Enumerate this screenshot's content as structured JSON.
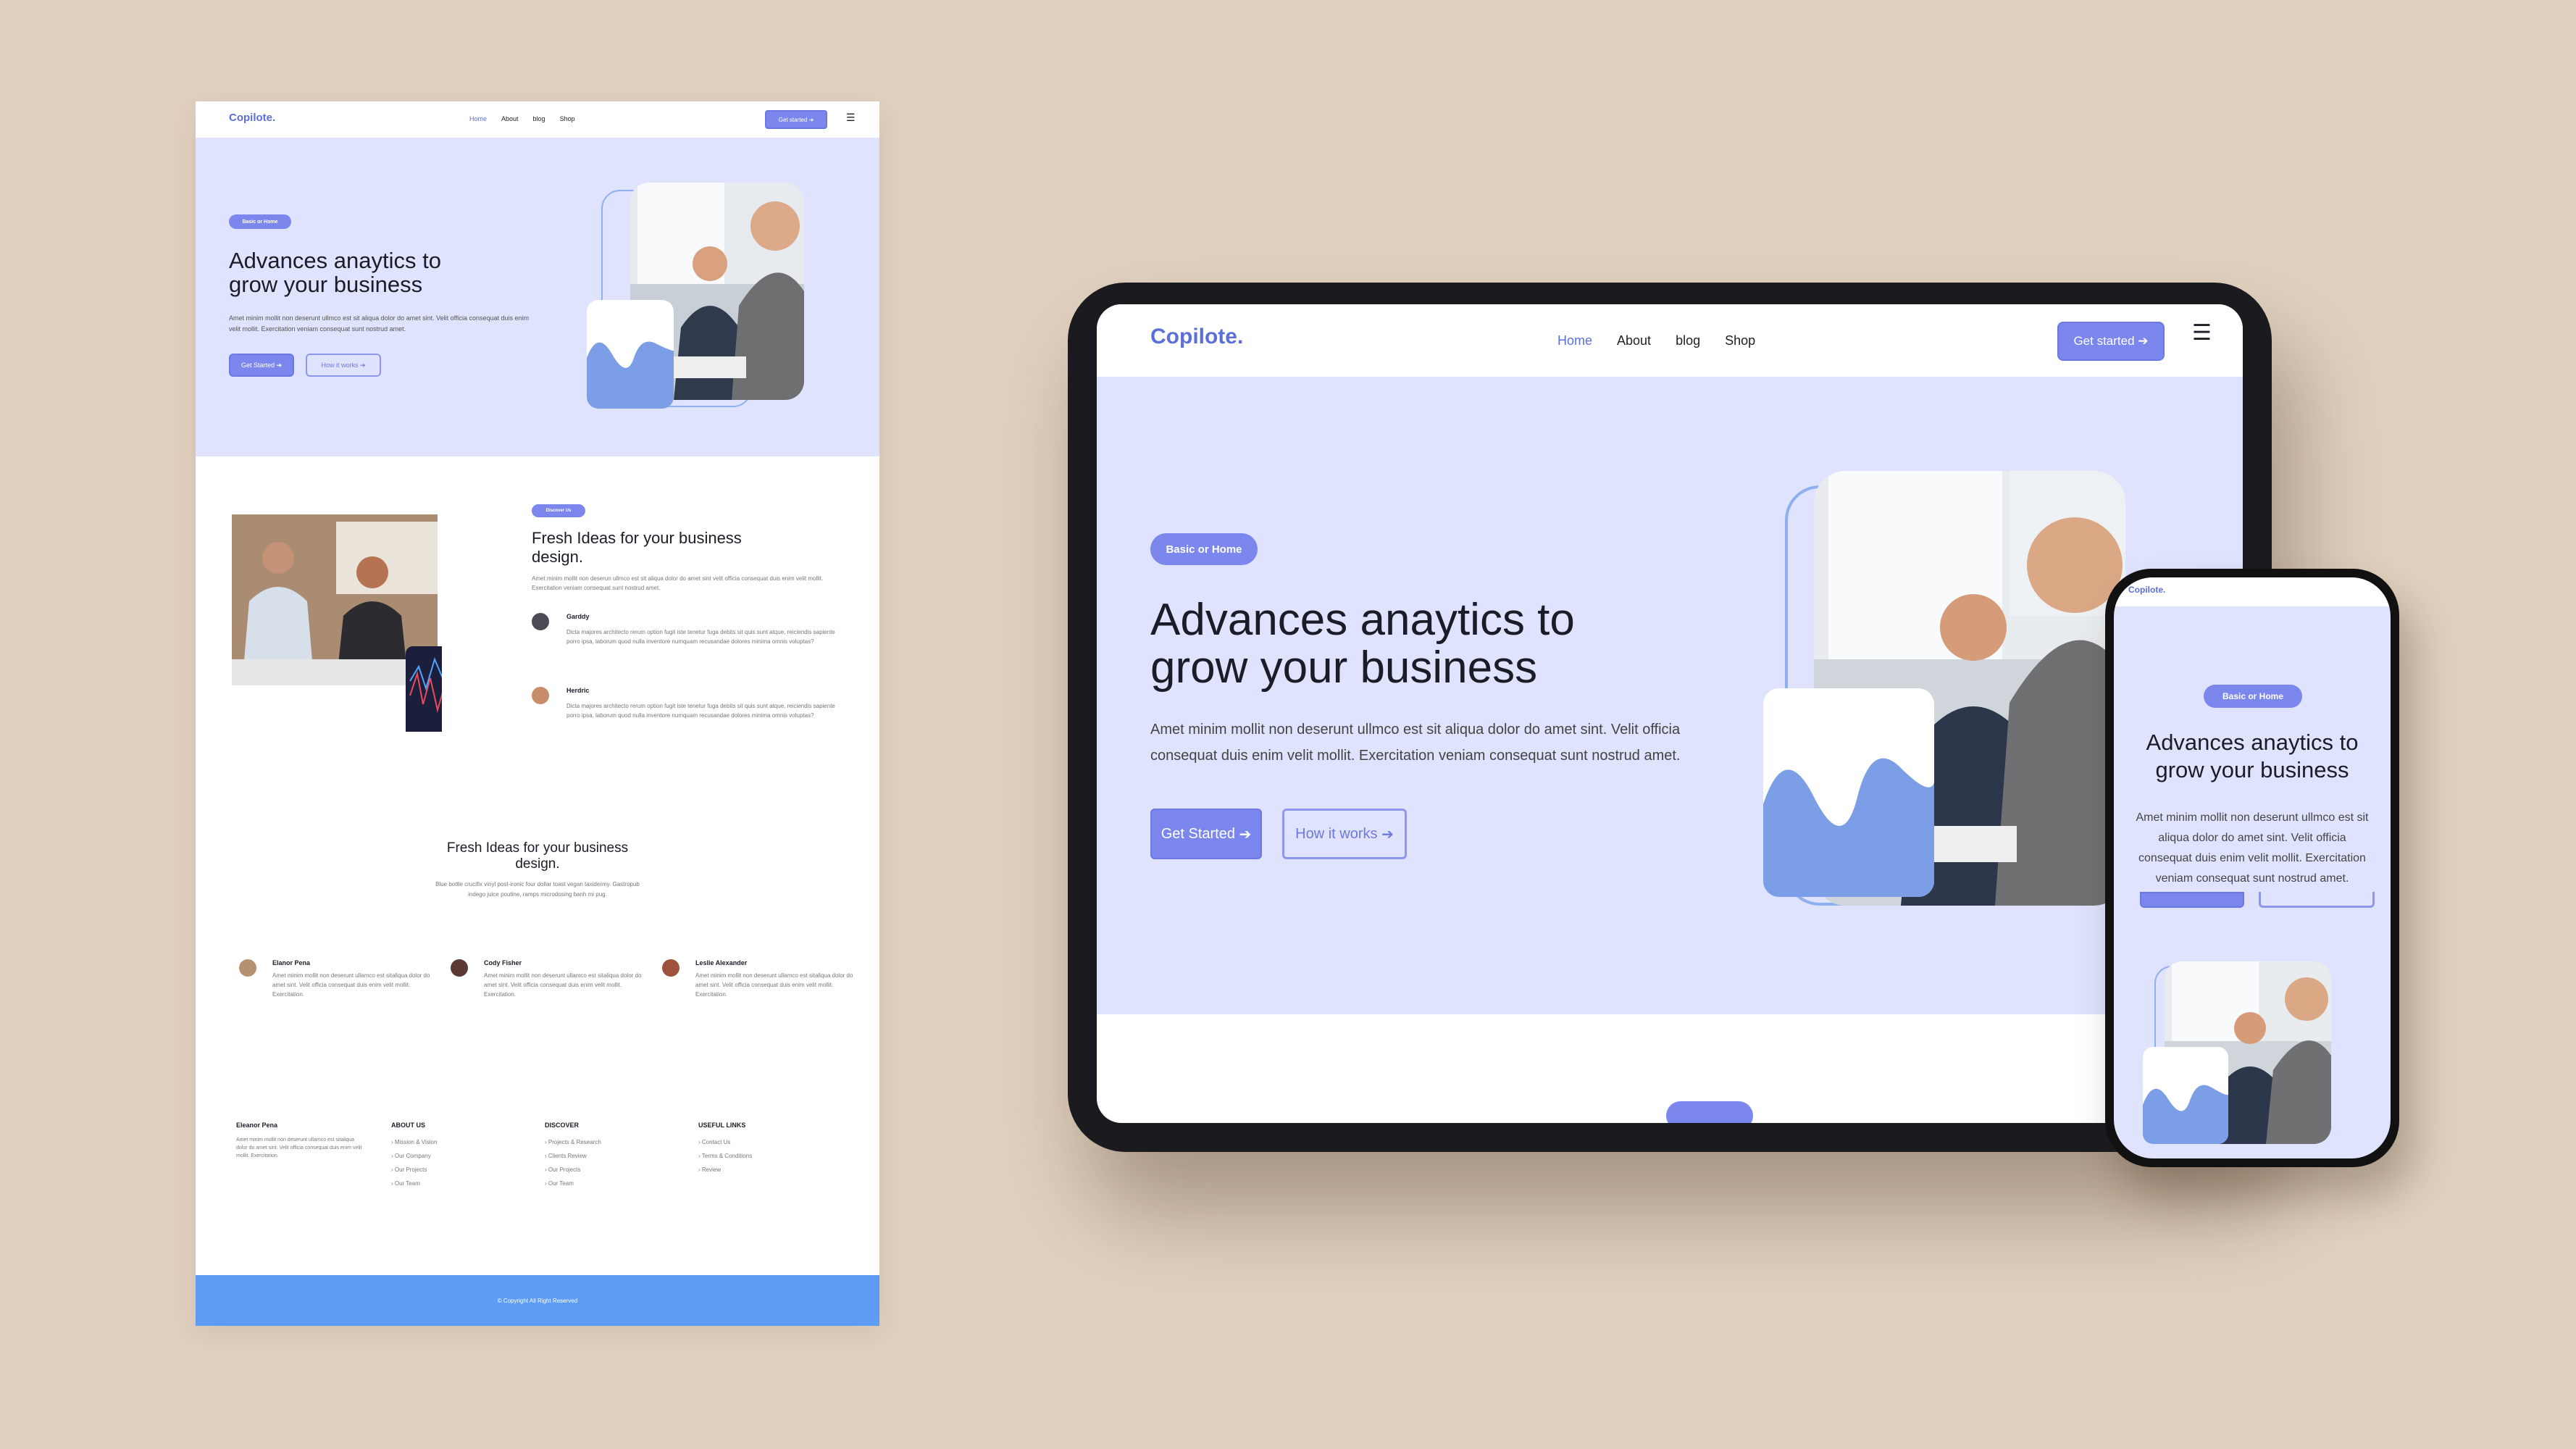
{
  "brand": {
    "logo": "Copilote.",
    "accent": "#7c87ee",
    "hero_bg": "#dfe3fd",
    "footer_bg": "#5d9bf5",
    "backdrop": "#e1d0bf"
  },
  "nav": {
    "items": [
      "Home",
      "About",
      "blog",
      "Shop"
    ],
    "cta": "Get started",
    "menu_icon": "hamburger-icon"
  },
  "hero": {
    "badge": "Basic or Home",
    "title_line1": "Advances anaytics to",
    "title_line2": "grow your business",
    "body": "Amet minim mollit non deserunt ullmco est sit aliqua dolor do amet sint. Velit officia consequat duis enim velit mollit. Exercitation veniam consequat sunt nostrud amet.",
    "body_line1": "Amet minim mollit non deserunt ullmco est sit aliqua dolor do amet sint. Velit officia",
    "body_line2": "consequat duis enim velit mollit. Exercitation veniam consequat sunt nostrud amet.",
    "primary": "Get Started",
    "secondary": "How it works"
  },
  "about": {
    "badge": "Discover Us",
    "title_line1": "Fresh Ideas for your business",
    "title_line2": "design.",
    "body": "Amet minim mollit non deserun ullmco est sit aliqua dolor do amet sint velit officia consequat duis enim velit mollit. Exercitation veniam consequat sunt nostrud amet.",
    "people": [
      {
        "name": "Garddy",
        "text": "Dicta majores architecto rerum option fugit iste tenetur fuga debits sit quis sunt atque, reiciendis sapiente porro ipsa, laborum quod nulla inventore numquam recusandae dolores minima omnis voluptas?"
      },
      {
        "name": "Herdric",
        "text": "Dicta majores architecto rerum option fugit iste tenetur fuga debits sit quis sunt atque, reiciendis sapiente porro ipsa, laborum quod nulla inventore numquam recusandae dolores minima omnis voluptas?"
      }
    ]
  },
  "testimonials": {
    "title_line1": "Fresh Ideas for your business",
    "title_line2": "design.",
    "sub_line1": "Blue bottle crucifix vinyl post-ironic four dollar toast vegan taxidermy. Gastropub",
    "sub_line2": "indego juice poutine, ramps microdosing banh mi pug.",
    "items": [
      {
        "name": "Elanor Pena",
        "text": "Amet minim mollit non deserunt ullamco est sitaliqua dolor do amet sint. Velit officia consequat duis enim velit mollit. Exercitation."
      },
      {
        "name": "Cody Fisher",
        "text": "Amet minim mollit non deserunt ullamco est sitaliqua dolor do amet sint. Velit officia consequat duis enim velit mollit. Exercitation."
      },
      {
        "name": "Leslie Alexander",
        "text": "Amet minim mollit non deserunt ullamco est sitaliqua dolor do amet sint. Velit officia consequat duis enim velit mollit. Exercitation."
      }
    ]
  },
  "footer": {
    "brand": "Eleanor Pena",
    "brand_text": "Amet minim mollit non deserunt ullamco est sitaliqua dolor do amet sint. Velit officia consequat duis enim velit mollit. Exercitation.",
    "columns": [
      {
        "title": "ABOUT US",
        "links": [
          "Mission & Vision",
          "Our Company",
          "Our Projects",
          "Our Team"
        ]
      },
      {
        "title": "DISCOVER",
        "links": [
          "Projects & Research",
          "Clients Review",
          "Our Projects",
          "Our Team"
        ]
      },
      {
        "title": "USEFUL LINKS",
        "links": [
          "Contact Us",
          "Terms & Conditions",
          "Review"
        ]
      }
    ],
    "copyright": "© Copyright All Right Reserved"
  }
}
